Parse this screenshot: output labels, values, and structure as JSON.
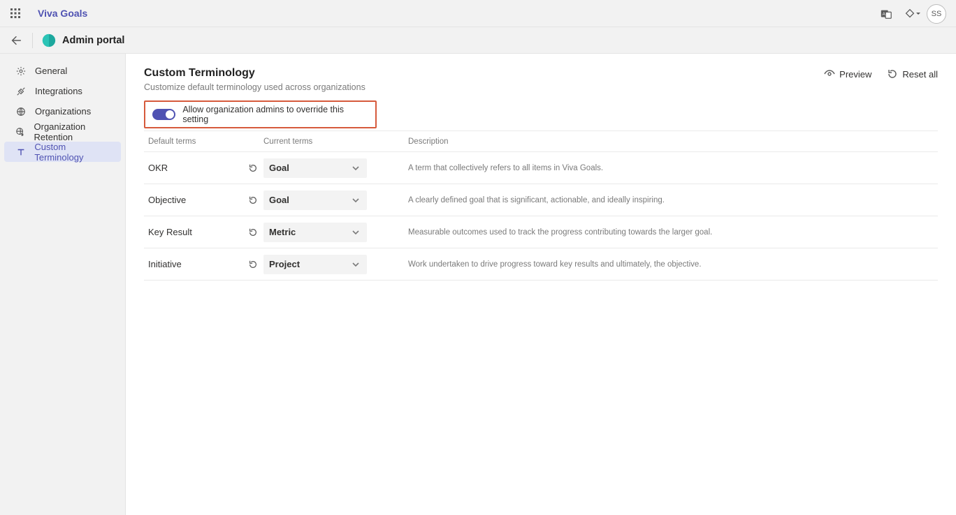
{
  "topbar": {
    "product_name": "Viva Goals",
    "avatar_initials": "SS"
  },
  "secondbar": {
    "portal_title": "Admin portal"
  },
  "sidebar": {
    "items": [
      {
        "label": "General",
        "icon": "gear-icon"
      },
      {
        "label": "Integrations",
        "icon": "plug-icon"
      },
      {
        "label": "Organizations",
        "icon": "globe-icon"
      },
      {
        "label": "Organization Retention",
        "icon": "globe-shield-icon"
      },
      {
        "label": "Custom Terminology",
        "icon": "text-icon"
      }
    ]
  },
  "page": {
    "title": "Custom Terminology",
    "subtitle": "Customize default terminology used across organizations",
    "actions": {
      "preview": "Preview",
      "reset_all": "Reset all"
    },
    "toggle_label": "Allow organization admins to override this setting",
    "columns": {
      "default": "Default terms",
      "current": "Current terms",
      "description": "Description"
    },
    "rows": [
      {
        "default": "OKR",
        "current": "Goal",
        "description": "A term that collectively refers to all items in Viva Goals."
      },
      {
        "default": "Objective",
        "current": "Goal",
        "description": "A clearly defined goal that is significant, actionable, and ideally inspiring."
      },
      {
        "default": "Key Result",
        "current": "Metric",
        "description": "Measurable outcomes used to track the progress contributing towards the larger goal."
      },
      {
        "default": "Initiative",
        "current": "Project",
        "description": "Work undertaken to drive progress toward key results and ultimately, the objective."
      }
    ]
  }
}
